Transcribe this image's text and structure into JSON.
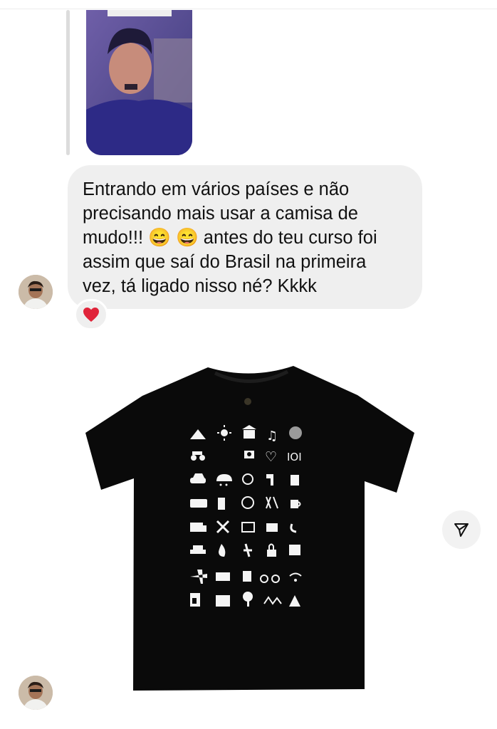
{
  "chat": {
    "incoming_message": {
      "text": "Entrando em vários países e não\nprecisando mais usar a camisa de\nmudo!!! 😄 😄  antes do teu curso foi\nassim que saí do Brasil na primeira\nvez, tá ligado nisso né? Kkkk",
      "reaction": "❤️"
    }
  },
  "icons": {
    "reply_bar": "reply-indicator",
    "avatar": "user-avatar",
    "reaction": "heart-icon",
    "share": "share-send-icon"
  },
  "colors": {
    "bubble": "#efefef",
    "text": "#111111",
    "heart": "#e0243a"
  }
}
